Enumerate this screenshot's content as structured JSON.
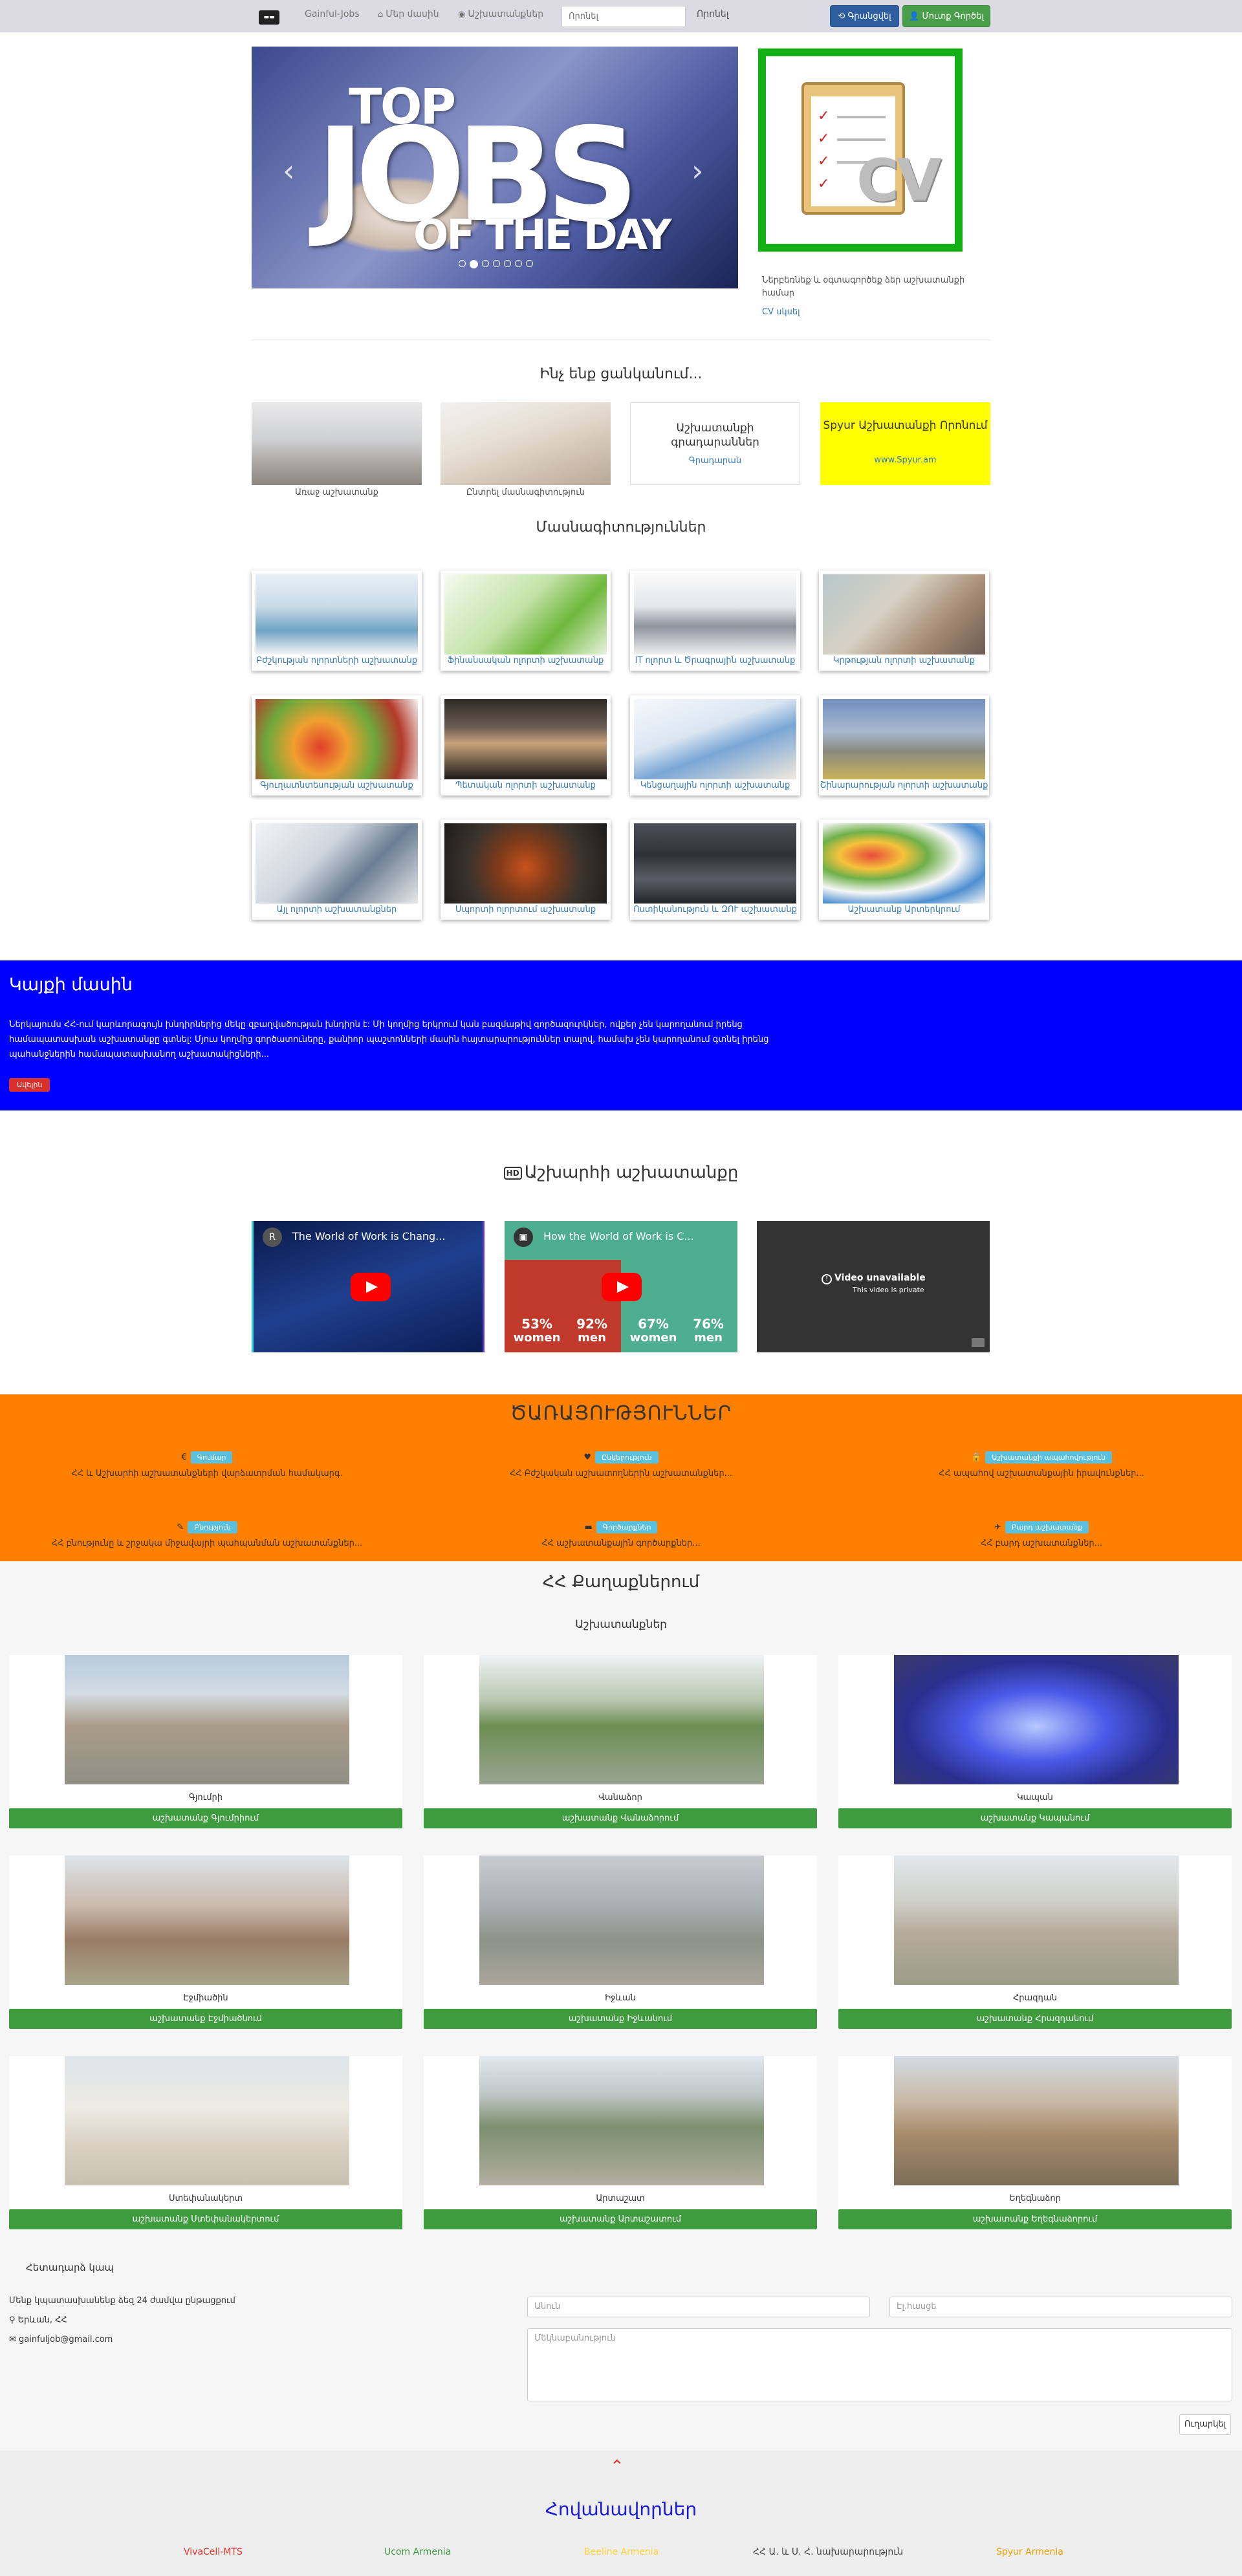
{
  "nav": {
    "brand": "Gainful-Jobs",
    "about": "Մեր մասին",
    "jobs": "Աշխատանքներ",
    "search_placeholder": "Որոնել",
    "search_button": "Որոնել",
    "login": "Գրանցվել",
    "register": "Մուտք Գործել"
  },
  "carousel": {
    "line1": "TOP",
    "line2": "JOBS",
    "line3": "OF THE DAY"
  },
  "cv": {
    "desc": "Ներբեռնեք և օգտագործեք ձեր աշխատանքի համար",
    "link": "CV սկսել"
  },
  "search_section": {
    "title": "Ինչ ենք ցանկանում...",
    "posted_caption": "Առաջ աշխատանք",
    "seek_caption": "Ընտրել մասնագիտություն",
    "ads_title": "Աշխատանքի գրադարաններ",
    "ads_link": "Գրադարան",
    "spyur_title": "Spyur Աշխատանքի Որոնում",
    "spyur_link": "www.Spyur.am"
  },
  "specialties_title": "Մասնագիտություններ",
  "specialties": [
    {
      "label": "Բժշկության ոլորտների աշխատանք"
    },
    {
      "label": "Ֆինանսական ոլորտի աշխատանք"
    },
    {
      "label": "IT ոլորտ և Ծրագրային աշխատանք"
    },
    {
      "label": "Կրթության ոլորտի աշխատանք"
    },
    {
      "label": "Գյուղատնտեսության աշխատանք"
    },
    {
      "label": "Պետական ոլորտի աշխատանք"
    },
    {
      "label": "Կենցաղային ոլորտի աշխատանք"
    },
    {
      "label": "Շինարարության ոլորտի աշխատանք"
    },
    {
      "label": "Այլ ոլորտի աշխատանքներ"
    },
    {
      "label": "Սպորտի ոլորտում աշխատանք"
    },
    {
      "label": "Ոստիկանություն և ԶՈՒ աշխատանք"
    },
    {
      "label": "Աշխատանք Արտերկրում"
    }
  ],
  "about": {
    "title": "Կայքի մասին",
    "text": "Ներկայումս ՀՀ-ում կարևորագույն խնդիրներից մեկը զբաղվածության խնդիրն է: Մի կողմից երկրում կան բազմաթիվ գործազուրկներ, ովքեր չեն կարողանում իրենց համապատասխան աշխատանքը գտնել: Մյուս կողմից գործատուները, քանիոր պաշտոնների մասին հայտարարություններ տալով, համախ չեն կարողանում գտնել իրենց պահանջներին համապատասխանող աշխատակիցների...",
    "more": "Ավելին"
  },
  "videos": {
    "hd": "HD",
    "title": "Աշխարհի աշխատանքը",
    "v1_title": "The World of Work is Chang...",
    "v1_avatar": "R",
    "v2_title": "How the World of Work is C...",
    "v2_stats": [
      {
        "pct": "53%",
        "who": "women"
      },
      {
        "pct": "92%",
        "who": "men"
      },
      {
        "pct": "67%",
        "who": "women"
      },
      {
        "pct": "76%",
        "who": "men"
      }
    ],
    "v3_unavailable": "Video unavailable",
    "v3_private": "This video is private"
  },
  "services": {
    "title": "ԾԱՌԱՅՈՒԹՅՈՒՆՆԵՐ",
    "items": [
      {
        "icon": "€",
        "pill": "Գումար",
        "desc": "ՀՀ և Աշխարհի աշխատանքների վարձատրման համակարգ."
      },
      {
        "icon": "♥",
        "pill": "Ընկերություն",
        "desc": "ՀՀ Բժշկական աշխատողներին աշխատանքներ..."
      },
      {
        "icon": "🔒",
        "pill": "Աշխատանքի ապահովություն",
        "desc": "ՀՀ ապահով աշխատանքային իրավունքներ..."
      },
      {
        "icon": "✎",
        "pill": "Բնություն",
        "desc": "ՀՀ բնությունը և շրջակա միջավայրի պահպանման աշխատանքներ..."
      },
      {
        "icon": "▬",
        "pill": "Գործարքներ",
        "desc": "ՀՀ աշխատանքային գործարքներ..."
      },
      {
        "icon": "✈",
        "pill": "Բարդ աշխատանք",
        "desc": "ՀՀ բարդ աշխատանքներ..."
      }
    ]
  },
  "cities": {
    "title": "ՀՀ Քաղաքներում",
    "subtitle": "Աշխատանքներ",
    "items": [
      {
        "name": "Գյումրի",
        "button": "աշխատանք Գյումրիում"
      },
      {
        "name": "Վանաձոր",
        "button": "աշխատանք Վանաձորում"
      },
      {
        "name": "Կապան",
        "button": "աշխատանք Կապանում"
      },
      {
        "name": "Էջմիածին",
        "button": "աշխատանք Էջմիածնում"
      },
      {
        "name": "Իջևան",
        "button": "աշխատանք Իջևանում"
      },
      {
        "name": "Հրազդան",
        "button": "աշխատանք Հրազդանում"
      },
      {
        "name": "Ստեփանակերտ",
        "button": "աշխատանք Ստեփանակերտում"
      },
      {
        "name": "Արտաշատ",
        "button": "աշխատանք Արտաշատում"
      },
      {
        "name": "Եղեգնաձոր",
        "button": "աշխատանք Եղեգնաձորում"
      }
    ]
  },
  "contact": {
    "title": "Հետադարձ կապ",
    "desc": "Մենք կպատասխանենք ձեզ 24 ժամվա ընթացքում",
    "location": "Երևան, ՀՀ",
    "email": "gainfuljob@gmail.com",
    "name_placeholder": "Անուն",
    "email_placeholder": "Էլ.հասցե",
    "message_placeholder": "Մեկնաբանություն",
    "send": "Ուղարկել"
  },
  "footer": {
    "title": "Հովանավորներ",
    "sponsors": [
      {
        "name": "VivaCell-MTS",
        "color": "#e8312a"
      },
      {
        "name": "Ucom Armenia",
        "color": "#3d9a3d"
      },
      {
        "name": "Beeline Armenia",
        "color": "#ffd233"
      },
      {
        "name": "ՀՀ Ա. և Ս. Հ. նախարարություն",
        "color": "#444444"
      },
      {
        "name": "Spyur Armenia",
        "color": "#f0a000"
      }
    ]
  }
}
